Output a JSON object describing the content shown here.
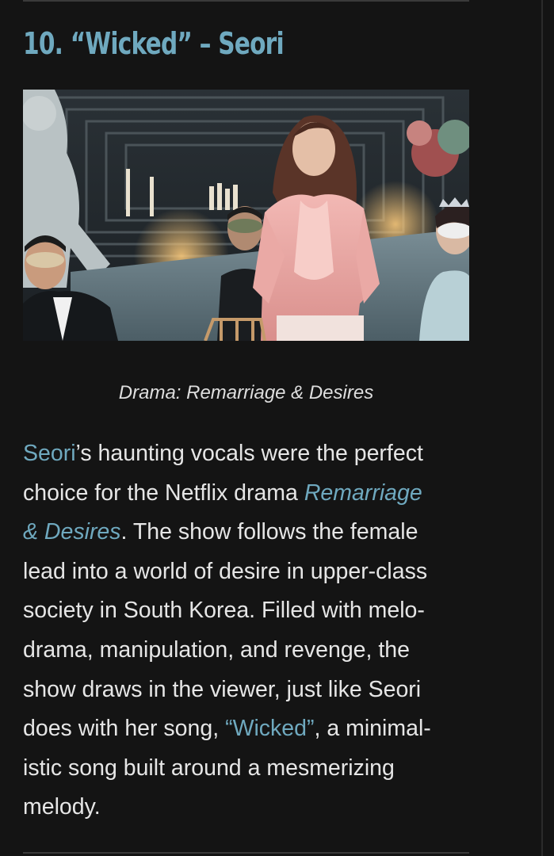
{
  "article": {
    "heading": "10. “Wicked” – Seori",
    "image_alt": "Scene from Remarriage & Desires: woman in pink ruffled blouse at a masked party",
    "caption": "Drama: Remarriage & Desires",
    "paragraph": {
      "l1_link": "Seori",
      "l1_text": "’s haunting vocals were the perfect",
      "l2_text": "choice for the Netflix drama ",
      "l2_link": "Remarriage",
      "l3_link": "& Desires",
      "l3_text": ". The show follows the female",
      "l4_text": "lead into a world of desire in upper-class",
      "l5_text": "society in South Korea. Filled with melo-",
      "l6_text": "drama, manipulation, and revenge, the",
      "l7_text": "show draws in the viewer, just like Seori",
      "l8_text": "does with her song, ",
      "l8_link": "“Wicked”",
      "l8_text2": ", a minimal-",
      "l9_text": "istic song built around a mesmerizing",
      "l10_text": "melody."
    }
  },
  "colors": {
    "background": "#141414",
    "accent_link": "#6fa9bf",
    "text": "#e6e6e6"
  }
}
